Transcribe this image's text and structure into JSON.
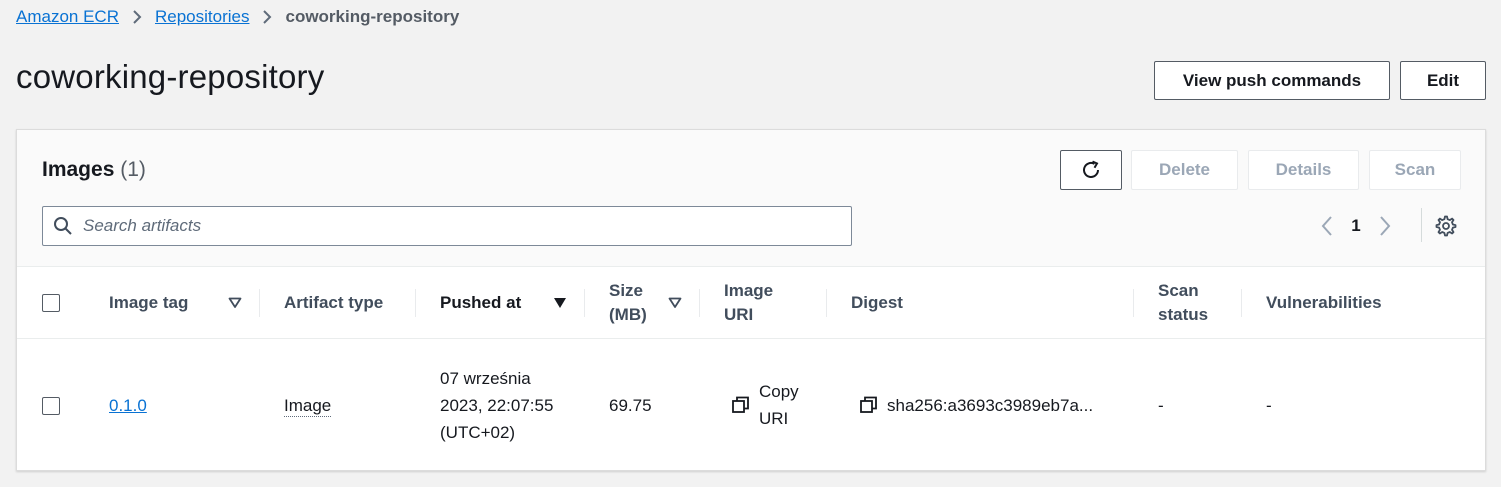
{
  "breadcrumb": {
    "items": [
      "Amazon ECR",
      "Repositories"
    ],
    "current": "coworking-repository"
  },
  "page_title": "coworking-repository",
  "actions": {
    "view_push_commands": "View push commands",
    "edit": "Edit"
  },
  "images_panel": {
    "title": "Images",
    "count": "(1)",
    "toolbar": {
      "refresh_icon": "refresh-icon",
      "delete": "Delete",
      "details": "Details",
      "scan": "Scan"
    },
    "search": {
      "placeholder": "Search artifacts",
      "value": ""
    },
    "pagination": {
      "current_page": "1"
    },
    "columns": {
      "image_tag": "Image tag",
      "artifact_type": "Artifact type",
      "pushed_at": "Pushed at",
      "size": "Size (MB)",
      "image_uri": "Image URI",
      "digest": "Digest",
      "scan_status": "Scan status",
      "vulnerabilities": "Vulnerabilities"
    },
    "sorted_column": "pushed_at",
    "rows": [
      {
        "image_tag": "0.1.0",
        "artifact_type": "Image",
        "pushed_at": "07 września 2023, 22:07:55 (UTC+02)",
        "size": "69.75",
        "image_uri": "Copy URI",
        "digest": "sha256:a3693c3989eb7a...",
        "scan_status": "-",
        "vulnerabilities": "-"
      }
    ]
  },
  "colors": {
    "link": "#0972d3",
    "background": "#f2f2f2",
    "text": "#16191f",
    "disabled": "#9ba7b6"
  }
}
